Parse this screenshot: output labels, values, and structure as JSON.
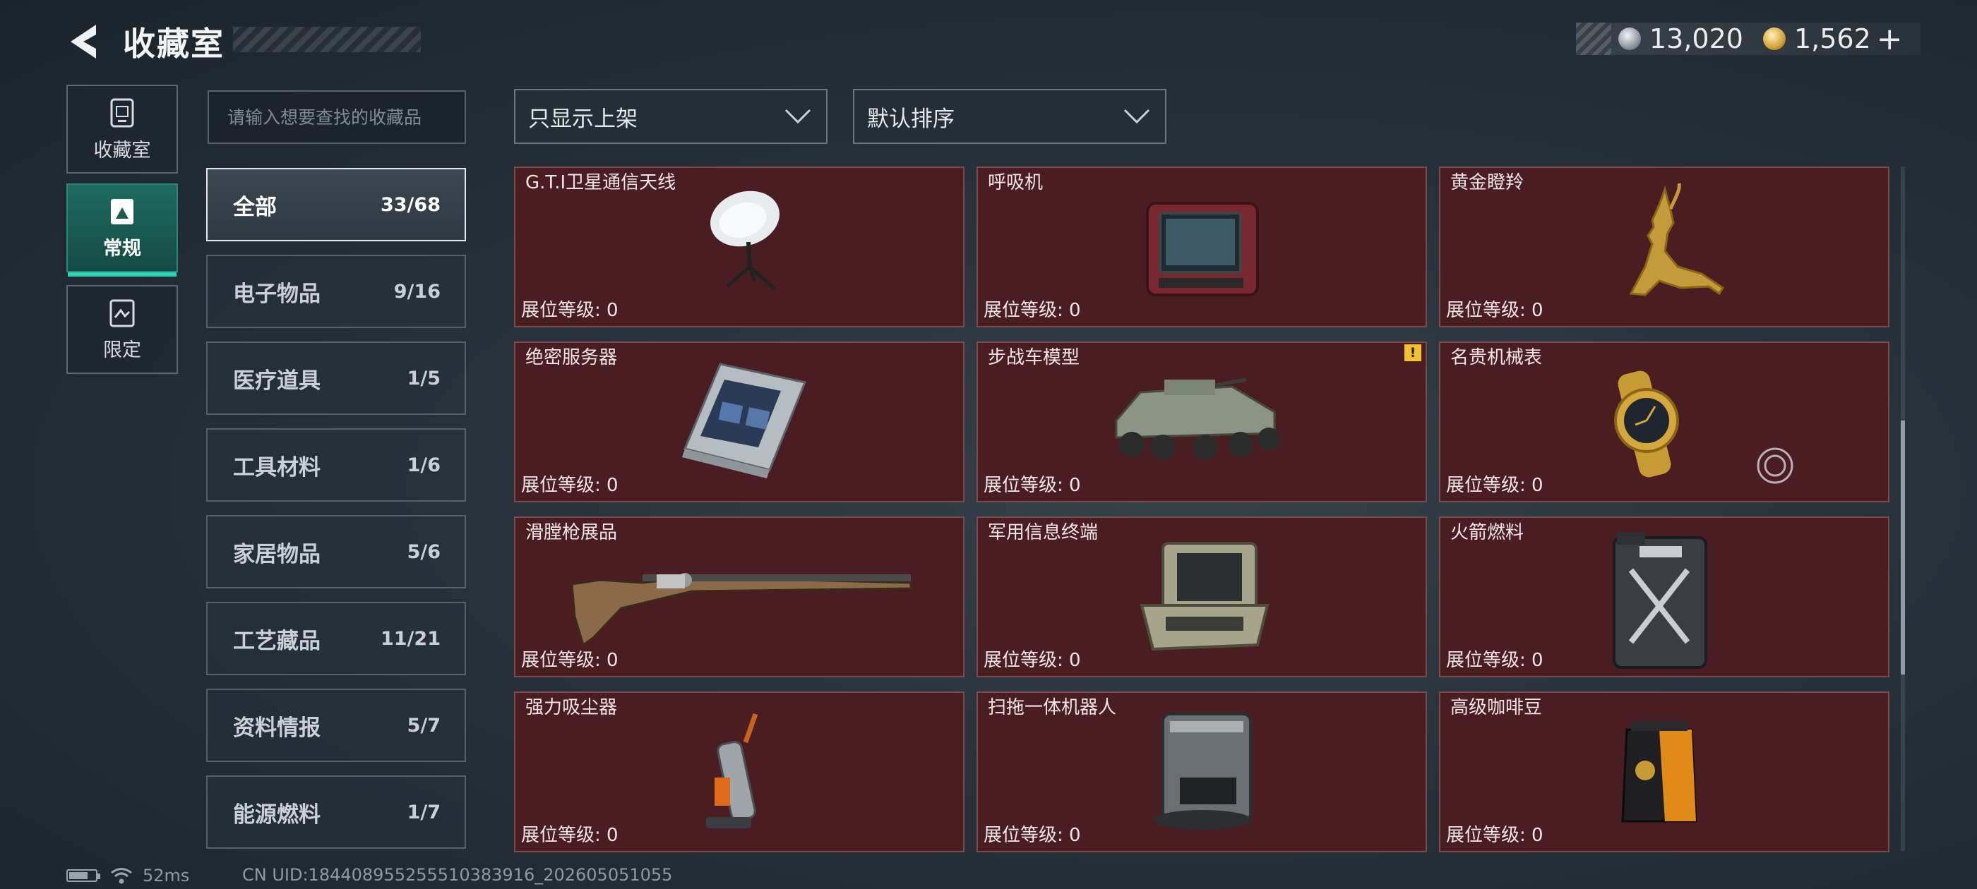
{
  "header": {
    "title": "收藏室",
    "currency": [
      {
        "icon": "silver-coin-icon",
        "value": "13,020"
      },
      {
        "icon": "gold-coin-icon",
        "value": "1,562"
      }
    ],
    "add_label": "+"
  },
  "side_tabs": [
    {
      "label": "收藏室",
      "icon": "collection-box-icon",
      "active": false
    },
    {
      "label": "常规",
      "icon": "picture-frame-icon",
      "active": true
    },
    {
      "label": "限定",
      "icon": "limited-frame-icon",
      "active": false
    }
  ],
  "search": {
    "placeholder": "请输入想要查找的收藏品",
    "value": ""
  },
  "categories": [
    {
      "name": "全部",
      "count": "33/68",
      "active": true
    },
    {
      "name": "电子物品",
      "count": "9/16",
      "active": false
    },
    {
      "name": "医疗道具",
      "count": "1/5",
      "active": false
    },
    {
      "name": "工具材料",
      "count": "1/6",
      "active": false
    },
    {
      "name": "家居物品",
      "count": "5/6",
      "active": false
    },
    {
      "name": "工艺藏品",
      "count": "11/21",
      "active": false
    },
    {
      "name": "资料情报",
      "count": "5/7",
      "active": false
    },
    {
      "name": "能源燃料",
      "count": "1/7",
      "active": false
    }
  ],
  "filters": {
    "display": "只显示上架",
    "sort": "默认排序"
  },
  "items": [
    {
      "name": "G.T.I卫星通信天线",
      "level": "展位等级: 0",
      "icon": "satellite-dish-icon"
    },
    {
      "name": "呼吸机",
      "level": "展位等级: 0",
      "icon": "ventilator-icon"
    },
    {
      "name": "黄金瞪羚",
      "level": "展位等级: 0",
      "icon": "golden-gazelle-icon"
    },
    {
      "name": "绝密服务器",
      "level": "展位等级: 0",
      "icon": "server-icon"
    },
    {
      "name": "步战车模型",
      "level": "展位等级: 0",
      "icon": "ifv-model-icon",
      "warning": "!"
    },
    {
      "name": "名贵机械表",
      "level": "展位等级: 0",
      "icon": "mechanical-watch-icon"
    },
    {
      "name": "滑膛枪展品",
      "level": "展位等级: 0",
      "icon": "musket-icon"
    },
    {
      "name": "军用信息终端",
      "level": "展位等级: 0",
      "icon": "military-terminal-icon"
    },
    {
      "name": "火箭燃料",
      "level": "展位等级: 0",
      "icon": "fuel-canister-icon"
    },
    {
      "name": "强力吸尘器",
      "level": "展位等级: 0",
      "icon": "vacuum-cleaner-icon"
    },
    {
      "name": "扫拖一体机器人",
      "level": "展位等级: 0",
      "icon": "robot-vacuum-icon"
    },
    {
      "name": "高级咖啡豆",
      "level": "展位等级: 0",
      "icon": "coffee-bag-icon"
    }
  ],
  "status": {
    "ping": "52ms",
    "uid": "CN UID:18440895525551038391​6_202605051055"
  },
  "colors": {
    "card_bg": "#4a1d22",
    "accent": "#2fd3b5",
    "warning": "#f2c230"
  }
}
